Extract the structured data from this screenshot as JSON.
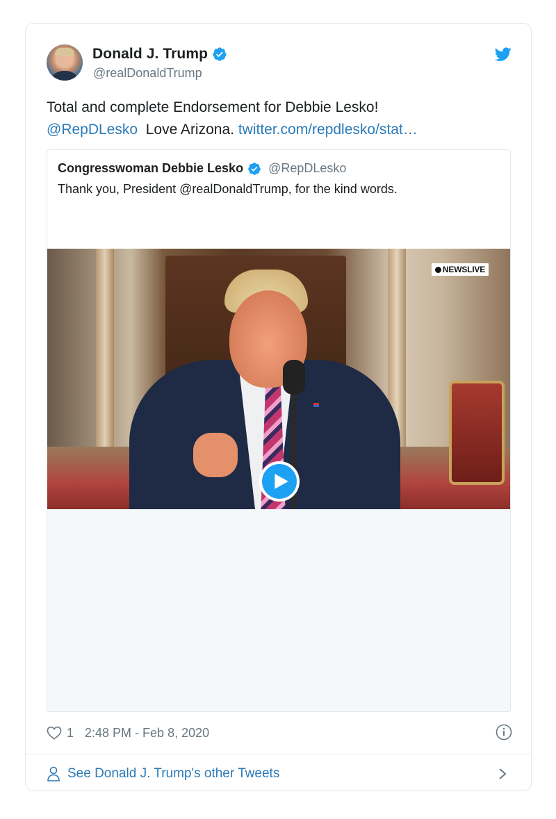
{
  "author": {
    "name": "Donald J. Trump",
    "handle": "@realDonaldTrump"
  },
  "tweet": {
    "text_line1": "Total and complete Endorsement for Debbie Lesko!",
    "mention": "@RepDLesko",
    "text_middle": "Love Arizona.",
    "link": "twitter.com/repdlesko/stat…"
  },
  "quoted": {
    "name": "Congresswoman Debbie Lesko",
    "handle": "@RepDLesko",
    "text": "Thank you, President @realDonaldTrump, for the kind words.",
    "video_badge": "NEWSLIVE"
  },
  "meta": {
    "like_count": "1",
    "timestamp": "2:48 PM - Feb 8, 2020"
  },
  "footer": {
    "label": "See Donald J. Trump's other Tweets"
  },
  "colors": {
    "link": "#2b7bb9",
    "verified": "#1da1f2",
    "twitter_blue": "#1da1f2",
    "muted": "#697882",
    "border": "#e1e8ed"
  },
  "icons": [
    "verified-badge-icon",
    "twitter-bird-icon",
    "play-icon",
    "heart-icon",
    "info-icon",
    "person-icon",
    "chevron-right-icon"
  ]
}
